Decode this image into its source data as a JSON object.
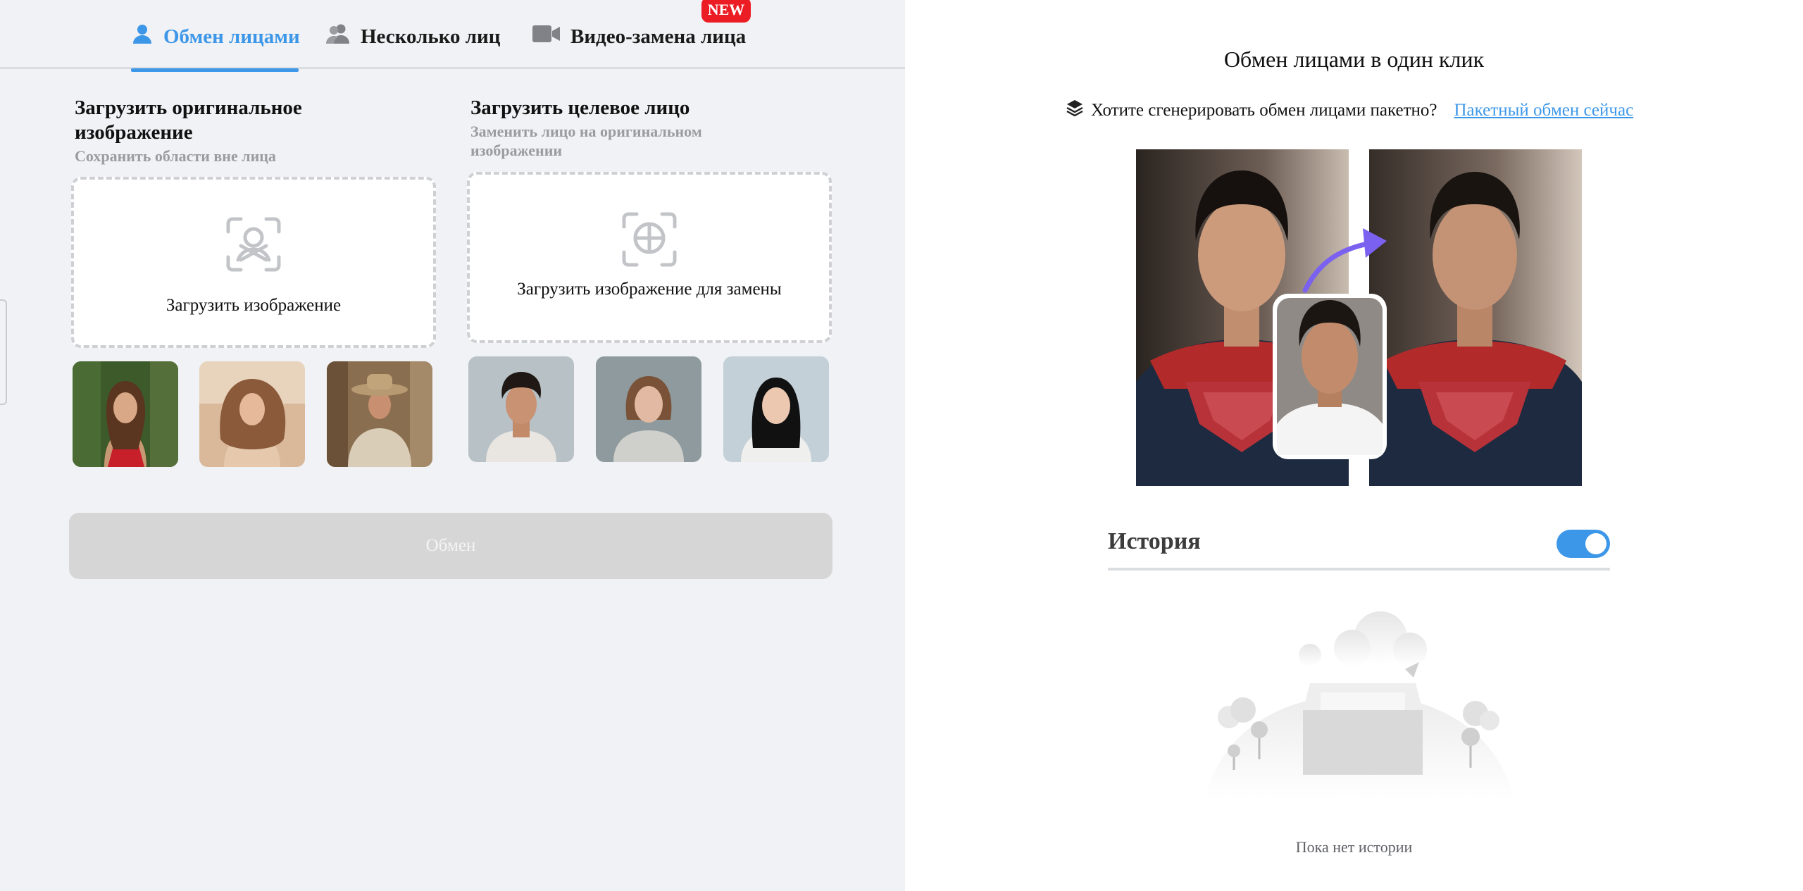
{
  "tabs": [
    {
      "label": "Обмен лицами",
      "icon": "user-icon",
      "active": true
    },
    {
      "label": "Несколько лиц",
      "icon": "users-icon",
      "active": false
    },
    {
      "label": "Видео-замена лица",
      "icon": "video-camera-icon",
      "active": false,
      "badge": "NEW"
    }
  ],
  "original": {
    "title": "Загрузить оригинальное изображение",
    "subtitle": "Сохранить области вне лица",
    "upload_label": "Загрузить изображение",
    "upload_icon": "face-scan-icon",
    "samples": [
      "sample-woman-red-dress",
      "sample-woman-beach",
      "sample-cowboy"
    ]
  },
  "target": {
    "title": "Загрузить целевое лицо",
    "subtitle": "Заменить лицо на оригинальном изображении",
    "upload_label": "Загрузить изображение для замены",
    "upload_icon": "face-target-icon",
    "samples": [
      "sample-man-curly",
      "sample-woman-freckles",
      "sample-woman-asian"
    ]
  },
  "swap_button": "Обмен",
  "right": {
    "title": "Обмен лицами в один клик",
    "batch_prompt": "Хотите сгенерировать обмен лицами пакетно?",
    "batch_link": "Пакетный обмен сейчас",
    "batch_icon": "layers-icon",
    "history_title": "История",
    "history_toggle_on": true,
    "empty_text": "Пока нет истории"
  },
  "colors": {
    "accent": "#3d97e8",
    "badge": "#ec1c24",
    "panel_bg": "#f1f2f5",
    "disabled_button": "#d6d6d6",
    "arrow": "#7b61f0"
  }
}
